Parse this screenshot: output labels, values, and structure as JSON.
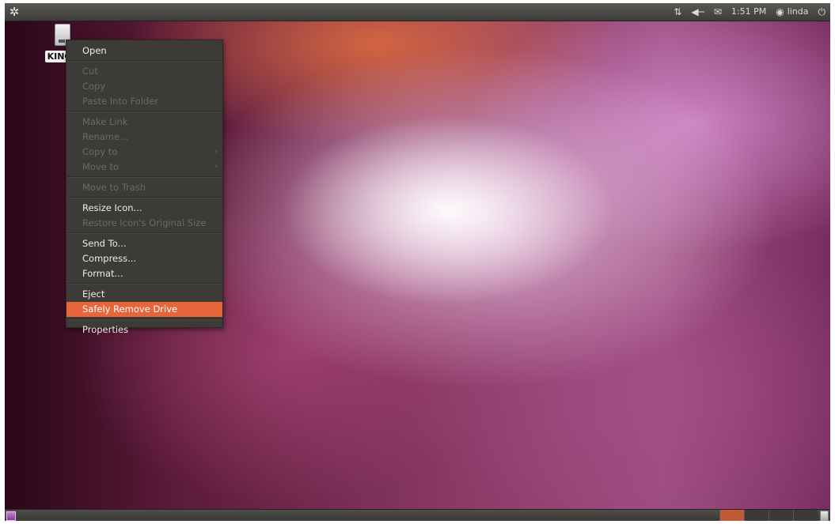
{
  "top_panel": {
    "time": "1:51 PM",
    "user": "linda",
    "icons": {
      "logo": "ubuntu-logo-icon",
      "network": "network-arrows-icon",
      "volume": "volume-icon",
      "mail": "mail-envelope-icon",
      "user": "user-status-icon",
      "power": "power-icon"
    }
  },
  "desktop": {
    "drive_label": "KINGS",
    "drive_icon": "usb-drive-icon"
  },
  "context_menu": {
    "items": [
      {
        "label": "Open",
        "enabled": true
      },
      {
        "label": "Cut",
        "enabled": false
      },
      {
        "label": "Copy",
        "enabled": false
      },
      {
        "label": "Paste Into Folder",
        "enabled": false
      },
      {
        "label": "Make Link",
        "enabled": false
      },
      {
        "label": "Rename...",
        "enabled": false
      },
      {
        "label": "Copy to",
        "enabled": false
      },
      {
        "label": "Move to",
        "enabled": false
      },
      {
        "label": "Move to Trash",
        "enabled": false
      },
      {
        "label": "Resize Icon...",
        "enabled": true
      },
      {
        "label": "Restore Icon's Original Size",
        "enabled": false
      },
      {
        "label": "Send To...",
        "enabled": true
      },
      {
        "label": "Compress...",
        "enabled": true
      },
      {
        "label": "Format...",
        "enabled": true
      },
      {
        "label": "Eject",
        "enabled": true
      },
      {
        "label": "Safely Remove Drive",
        "enabled": true,
        "highlighted": true
      },
      {
        "label": "Properties",
        "enabled": true
      }
    ],
    "submenu_arrow": "›"
  },
  "bottom_panel": {
    "icons": {
      "show_desktop": "show-desktop-icon",
      "trash": "trash-icon"
    }
  },
  "colors": {
    "highlight": "#e7653a",
    "menu_bg": "#3c3b37",
    "panel_bg": "#3d3c38"
  }
}
